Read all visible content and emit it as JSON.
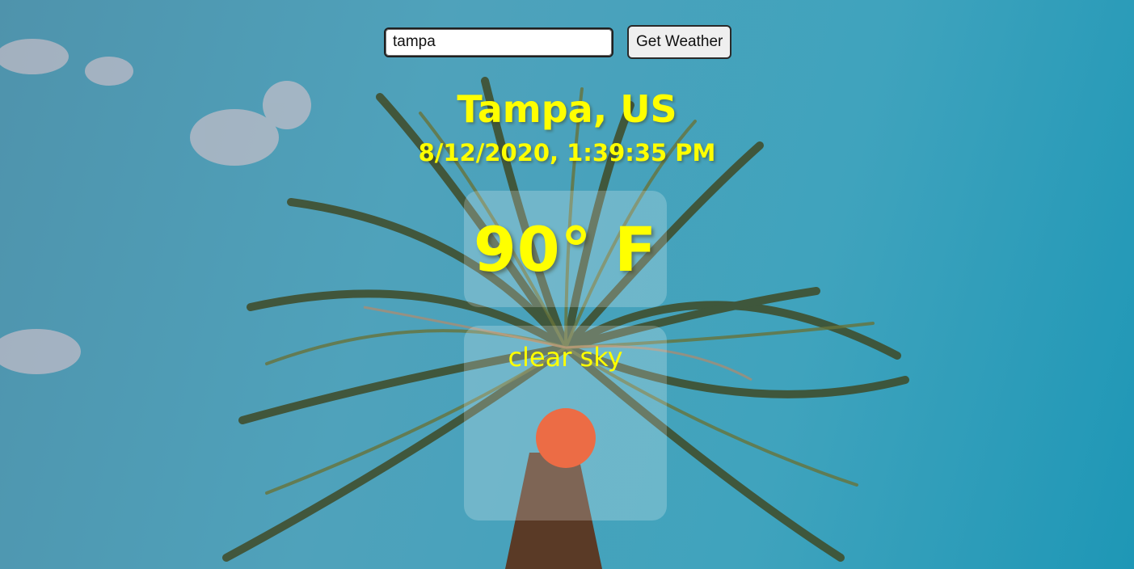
{
  "search": {
    "value": "tampa",
    "button_label": "Get Weather"
  },
  "location": {
    "city": "Tampa, US",
    "datetime": "8/12/2020, 1:39:35 PM"
  },
  "weather": {
    "temperature": "90° F",
    "condition": "clear sky",
    "icon": "sun-icon",
    "icon_color": "#ec6c45"
  },
  "colors": {
    "accent_text": "#ffff00",
    "sky": "#4fa2bb"
  }
}
